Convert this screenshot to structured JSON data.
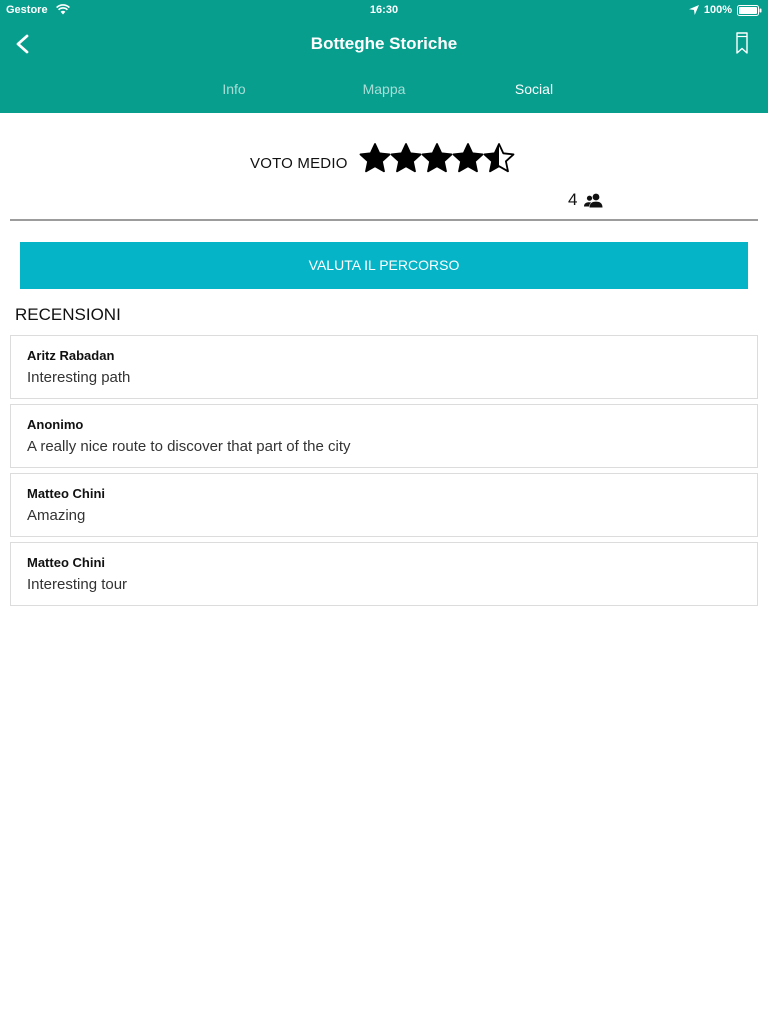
{
  "status_bar": {
    "carrier": "Gestore",
    "time": "16:30",
    "battery": "100%"
  },
  "nav": {
    "title": "Botteghe Storiche",
    "back_icon": "chevron-left-icon",
    "bookmark_icon": "bookmark-icon"
  },
  "tabs": [
    {
      "label": "Info",
      "active": false
    },
    {
      "label": "Mappa",
      "active": false
    },
    {
      "label": "Social",
      "active": true
    }
  ],
  "rating": {
    "label": "VOTO MEDIO",
    "value": 4.5,
    "max": 5,
    "votes": "4",
    "votes_icon": "people-icon"
  },
  "rate_button": {
    "label": "VALUTA IL PERCORSO"
  },
  "reviews_section": {
    "title": "RECENSIONI",
    "items": [
      {
        "author": "Aritz Rabadan",
        "text": "Interesting path"
      },
      {
        "author": "Anonimo",
        "text": "A really nice route to discover that part of the city"
      },
      {
        "author": "Matteo Chini",
        "text": "Amazing"
      },
      {
        "author": "Matteo Chini",
        "text": "Interesting tour"
      }
    ]
  },
  "colors": {
    "header": "#079e8d",
    "button": "#05b4c6"
  }
}
